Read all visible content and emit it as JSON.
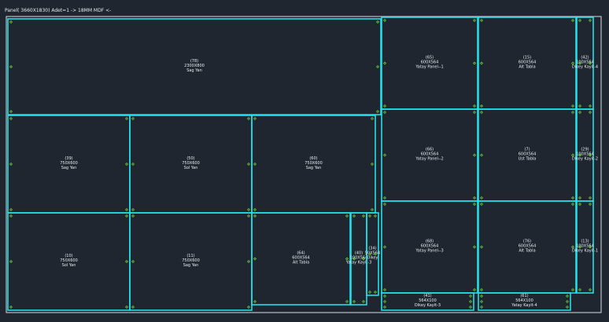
{
  "header": {
    "text": "Panel( 3660X1830) Adet=1 -> 18MM MDF <-"
  },
  "colors": {
    "background": "#1f2630",
    "panel_border": "#d8dde3",
    "part_border": "#22e0e8",
    "marker": "#7dff3a",
    "text": "#e8ecf0"
  },
  "parts": [
    {
      "id": "(78)",
      "size": "2300X800",
      "name": "Sag Yan"
    },
    {
      "id": "(65)",
      "size": "600X564",
      "name": "Yatay Panel--1"
    },
    {
      "id": "(15)",
      "size": "600X564",
      "name": "Alt Tabla"
    },
    {
      "id": "(42)",
      "size": "100X564",
      "name": "Dikey Kayit-4"
    },
    {
      "id": "(39)",
      "size": "750X600",
      "name": "Sag Yan"
    },
    {
      "id": "(50)",
      "size": "750X600",
      "name": "Sol Yan"
    },
    {
      "id": "(60)",
      "size": "750X600",
      "name": "Sag Yan"
    },
    {
      "id": "(66)",
      "size": "600X564",
      "name": "Yatay Panel--2"
    },
    {
      "id": "(7)",
      "size": "600X564",
      "name": "Ust Tabla"
    },
    {
      "id": "(29)",
      "size": "100X564",
      "name": "Dikey Kayit-2"
    },
    {
      "id": "(10)",
      "size": "750X600",
      "name": "Sol Yan"
    },
    {
      "id": "(11)",
      "size": "750X600",
      "name": "Sag Yan"
    },
    {
      "id": "(64)",
      "size": "600X564",
      "name": "Alt Tabla"
    },
    {
      "id": "(40)",
      "size": "100X564",
      "name": "Yatay Kayit-3"
    },
    {
      "id": "(34)",
      "size": "50X564",
      "name": "Dikey"
    },
    {
      "id": "(68)",
      "size": "600X564",
      "name": "Yatay Panel--3"
    },
    {
      "id": "(76)",
      "size": "600X564",
      "name": "Alt Tabla"
    },
    {
      "id": "(13)",
      "size": "100X564",
      "name": "Dikey Kayit-1"
    },
    {
      "id": "(41)",
      "size": "564X100",
      "name": "Dikey Kayit-3"
    },
    {
      "id": "(61)",
      "size": "564X100",
      "name": "Yatay Kayit-4"
    }
  ]
}
